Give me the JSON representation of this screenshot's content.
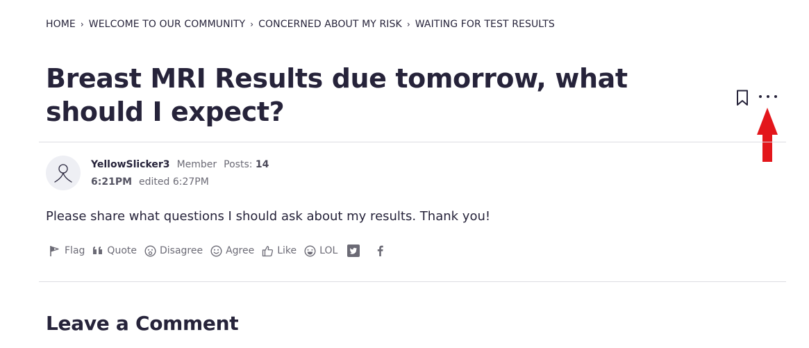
{
  "breadcrumb": [
    "HOME",
    "WELCOME TO OUR COMMUNITY",
    "CONCERNED ABOUT MY RISK",
    "WAITING FOR TEST RESULTS"
  ],
  "breadcrumb_separator": "›",
  "discussion": {
    "title": "Breast MRI Results due tomorrow, what should I expect?"
  },
  "post": {
    "author": "YellowSlicker3",
    "role": "Member",
    "posts_label": "Posts:",
    "posts_count": "14",
    "time": "6:21PM",
    "edited": "edited 6:27PM",
    "body": "Please share what questions I should ask about my results. Thank you!"
  },
  "reactions": {
    "flag": "Flag",
    "quote": "Quote",
    "disagree": "Disagree",
    "agree": "Agree",
    "like": "Like",
    "lol": "LOL"
  },
  "comment_section": {
    "heading": "Leave a Comment"
  },
  "colors": {
    "text": "#26233a",
    "muted": "#6b6a75",
    "divider": "#dcdce2",
    "annotation_arrow": "#e3161b"
  }
}
